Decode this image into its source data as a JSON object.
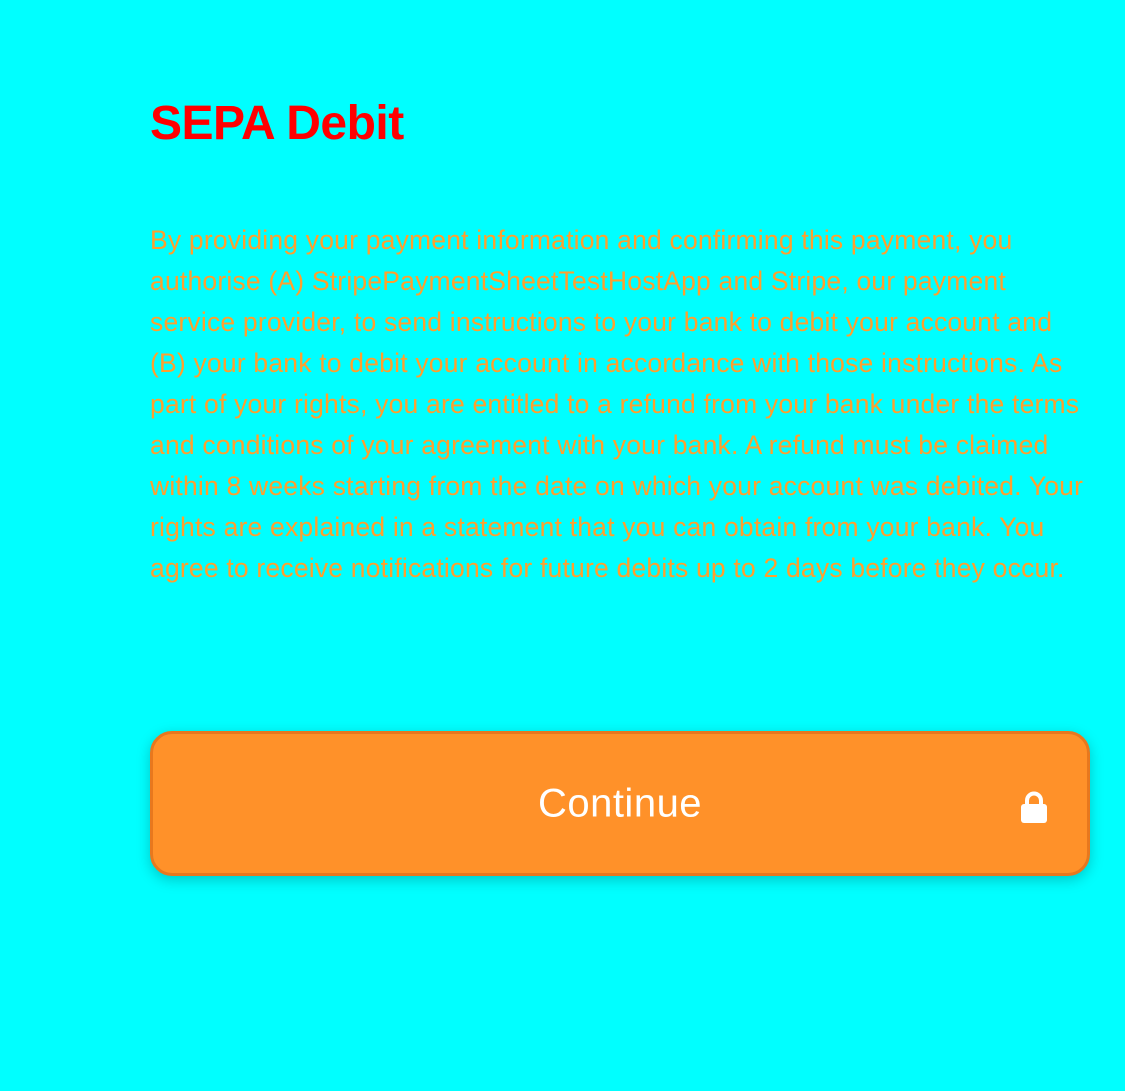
{
  "colors": {
    "background": "#00FFFF",
    "title": "#FF0000",
    "body_text": "#FF9F2E",
    "button_bg": "#FF9129",
    "button_text": "#FFFFFF"
  },
  "sheet": {
    "title": "SEPA Debit",
    "mandate_text": "By providing your payment information and confirming this payment, you authorise (A) StripePaymentSheetTestHostApp and Stripe, our payment service provider, to send instructions to your bank to debit your account and (B) your bank to debit your account in accordance with those instructions. As part of your rights, you are entitled to a refund from your bank under the terms and conditions of your agreement with your bank. A refund must be claimed within 8 weeks starting from the date on which your account was debited. Your rights are explained in a statement that you can obtain from your bank. You agree to receive notifications for future debits up to 2 days before they occur.",
    "continue_button": {
      "label": "Continue",
      "icon": "lock-icon"
    }
  }
}
